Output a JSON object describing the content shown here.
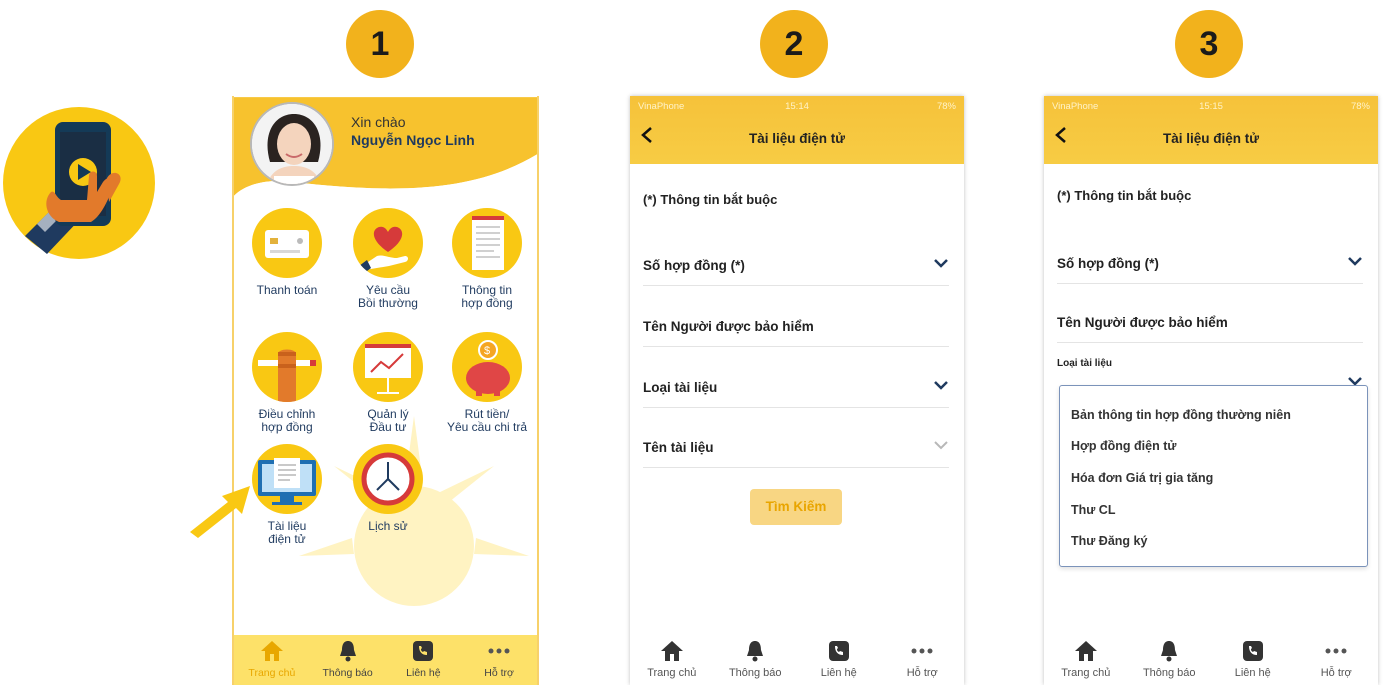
{
  "steps": [
    "1",
    "2",
    "3"
  ],
  "colors": {
    "brand_yellow": "#f9c813",
    "badge": "#f2b21c",
    "navy": "#1f3a5f",
    "active_tab": "#e8a700",
    "button_text": "#e9a500"
  },
  "home": {
    "greeting": "Xin chào",
    "user_name": "Nguyễn Ngọc Linh",
    "tiles": [
      {
        "icon": "payment-card-icon",
        "lines": [
          "Thanh toán"
        ]
      },
      {
        "icon": "heart-hand-icon",
        "lines": [
          "Yêu cầu",
          "Bồi thường"
        ]
      },
      {
        "icon": "contract-document-icon",
        "lines": [
          "Thông tin",
          "hợp đồng"
        ]
      },
      {
        "icon": "hand-pencil-icon",
        "lines": [
          "Điều chỉnh",
          "hợp đồng"
        ]
      },
      {
        "icon": "investment-chart-icon",
        "lines": [
          "Quản lý",
          "Đầu tư"
        ]
      },
      {
        "icon": "piggy-bank-icon",
        "lines": [
          "Rút tiền/",
          "Yêu cầu chi trả"
        ]
      },
      {
        "icon": "monitor-document-icon",
        "lines": [
          "Tài liệu",
          "điện tử"
        ]
      },
      {
        "icon": "clock-icon",
        "lines": [
          "Lịch sử"
        ]
      }
    ],
    "tabs": [
      "Trang chủ",
      "Thông báo",
      "Liên hệ",
      "Hỗ trợ"
    ]
  },
  "form": {
    "status": {
      "carrier": "VinaPhone",
      "time_a": "15:14",
      "time_b": "15:15",
      "battery": "78%"
    },
    "title": "Tài liệu điện tử",
    "required_note": "(*) Thông tin bắt buộc",
    "contract_no": "Số hợp đồng (*)",
    "insured_name": "Tên Người được bảo hiểm",
    "doc_type": "Loại tài liệu",
    "doc_name": "Tên tài liệu",
    "search": "Tìm Kiếm",
    "doc_type_options": [
      "Bản thông tin hợp đồng thường niên",
      "Hợp đồng điện tử",
      "Hóa đơn Giá trị gia tăng",
      "Thư CL",
      "Thư Đăng ký"
    ],
    "tabs": [
      "Trang chủ",
      "Thông báo",
      "Liên hệ",
      "Hỗ trợ"
    ]
  }
}
